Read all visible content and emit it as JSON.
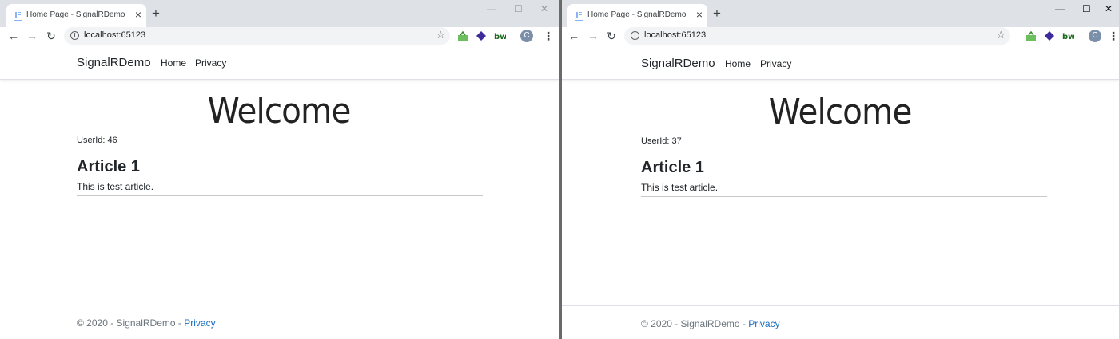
{
  "windows": [
    {
      "tab": {
        "title": "Home Page - SignalRDemo"
      },
      "address": {
        "url": "localhost:65123"
      },
      "profile_initial": "C",
      "page": {
        "brand": "SignalRDemo",
        "nav": [
          "Home",
          "Privacy"
        ],
        "heading": "Welcome",
        "user_id": "UserId: 46",
        "article": {
          "title": "Article 1",
          "body": "This is test article."
        },
        "footer": {
          "text": "© 2020 - SignalRDemo - ",
          "link": "Privacy"
        }
      }
    },
    {
      "tab": {
        "title": "Home Page - SignalRDemo"
      },
      "address": {
        "url": "localhost:65123"
      },
      "profile_initial": "C",
      "page": {
        "brand": "SignalRDemo",
        "nav": [
          "Home",
          "Privacy"
        ],
        "heading": "Welcome",
        "user_id": "UserId: 37",
        "article": {
          "title": "Article 1",
          "body": "This is test article."
        },
        "footer": {
          "text": "© 2020 - SignalRDemo - ",
          "link": "Privacy"
        }
      }
    }
  ],
  "colors": {
    "link": "#1b6ec2",
    "tabstrip": "#dee1e6",
    "omnibox": "#f1f3f4",
    "text": "#212529",
    "muted": "#6c757d"
  },
  "icons": [
    "page-favicon",
    "close-icon",
    "plus-icon",
    "minimize-icon",
    "maximize-icon",
    "back-arrow-icon",
    "forward-arrow-icon",
    "reload-icon",
    "info-icon",
    "star-icon",
    "extension-icon",
    "kebab-menu-icon"
  ]
}
